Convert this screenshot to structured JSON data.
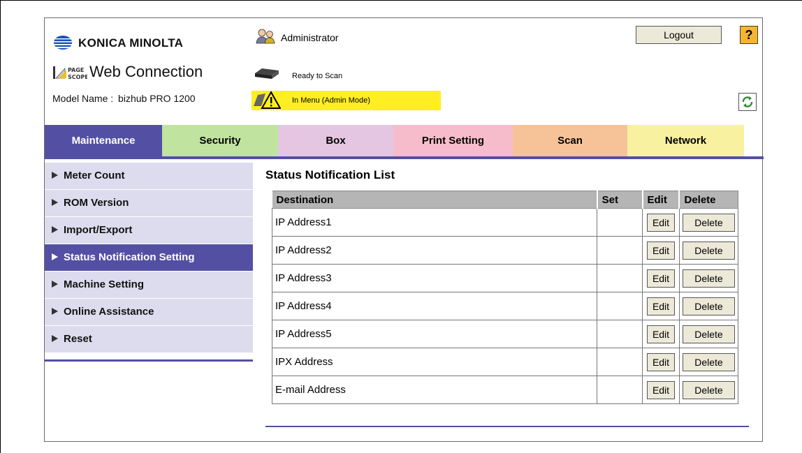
{
  "header": {
    "brand": "KONICA MINOLTA",
    "product_small": "PAGE\nSCOPE",
    "product": "Web Connection",
    "model_label": "Model Name :",
    "model_value": "bizhub PRO 1200",
    "user": "Administrator",
    "status_device": "Ready to Scan",
    "status_mode": "In Menu (Admin Mode)",
    "logout_label": "Logout",
    "help_label": "?"
  },
  "tabs": [
    {
      "label": "Maintenance",
      "active": true
    },
    {
      "label": "Security"
    },
    {
      "label": "Box"
    },
    {
      "label": "Print Setting"
    },
    {
      "label": "Scan"
    },
    {
      "label": "Network"
    }
  ],
  "sidebar": {
    "items": [
      {
        "label": "Meter Count"
      },
      {
        "label": "ROM Version"
      },
      {
        "label": "Import/Export"
      },
      {
        "label": "Status Notification Setting",
        "active": true
      },
      {
        "label": "Machine Setting"
      },
      {
        "label": "Online Assistance"
      },
      {
        "label": "Reset"
      }
    ]
  },
  "main": {
    "title": "Status Notification List",
    "columns": [
      "Destination",
      "Set",
      "Edit",
      "Delete"
    ],
    "rows": [
      {
        "destination": "IP Address1",
        "set": "",
        "edit": "Edit",
        "delete": "Delete"
      },
      {
        "destination": "IP Address2",
        "set": "",
        "edit": "Edit",
        "delete": "Delete"
      },
      {
        "destination": "IP Address3",
        "set": "",
        "edit": "Edit",
        "delete": "Delete"
      },
      {
        "destination": "IP Address4",
        "set": "",
        "edit": "Edit",
        "delete": "Delete"
      },
      {
        "destination": "IP Address5",
        "set": "",
        "edit": "Edit",
        "delete": "Delete"
      },
      {
        "destination": "IPX Address",
        "set": "",
        "edit": "Edit",
        "delete": "Delete"
      },
      {
        "destination": "E-mail Address",
        "set": "",
        "edit": "Edit",
        "delete": "Delete"
      }
    ]
  },
  "icons": {
    "logo": "konica-minolta-globe-icon",
    "pagescope": "pagescope-logo-icon",
    "admin": "administrator-icon",
    "scanner": "scanner-icon",
    "warning": "warning-icon",
    "refresh": "refresh-icon"
  },
  "colors": {
    "accent": "#5350a4",
    "sidebar_bg": "#dcdcee",
    "tab_security": "#c0e4a0",
    "tab_box": "#e4c6e2",
    "tab_print": "#f6bccb",
    "tab_scan": "#f6c398",
    "tab_network": "#f7f1a0",
    "warning_bg": "#ffee22",
    "help_button": "#f6b530"
  }
}
